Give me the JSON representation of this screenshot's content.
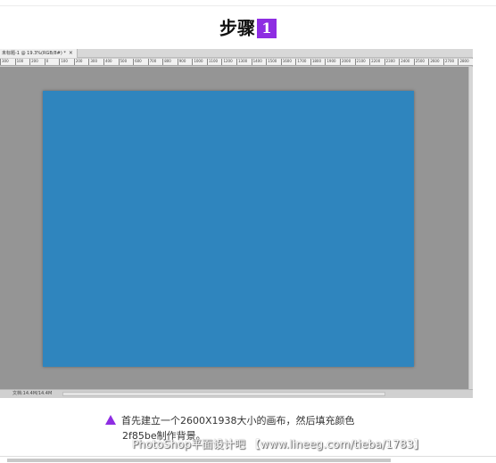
{
  "step": {
    "word": "步骤",
    "number": "1",
    "accent_color": "#8e2de2"
  },
  "photoshop": {
    "doc_tab_label": "未标题-1 @ 19.3%(RGB/8#) *",
    "close_glyph": "×",
    "ruler_ticks": [
      "300",
      "100",
      "200",
      "0",
      "100",
      "200",
      "300",
      "400",
      "500",
      "600",
      "700",
      "800",
      "900",
      "1000",
      "1100",
      "1200",
      "1300",
      "1400",
      "1500",
      "1600",
      "1700",
      "1800",
      "1900",
      "2000",
      "2100",
      "2200",
      "2300",
      "2400",
      "2500",
      "2600",
      "2700",
      "2800"
    ],
    "status_text": "文档:14.4M/14.4M",
    "canvas_color": "#2f85be",
    "workspace_color": "#959595"
  },
  "caption": {
    "line1": "首先建立一个2600X1938大小的画布，然后填充颜色",
    "line2": "2f85be制作背景。"
  },
  "watermark": "PhotoShop平面设计吧 【www.lineeg.com/tieba/1783】"
}
